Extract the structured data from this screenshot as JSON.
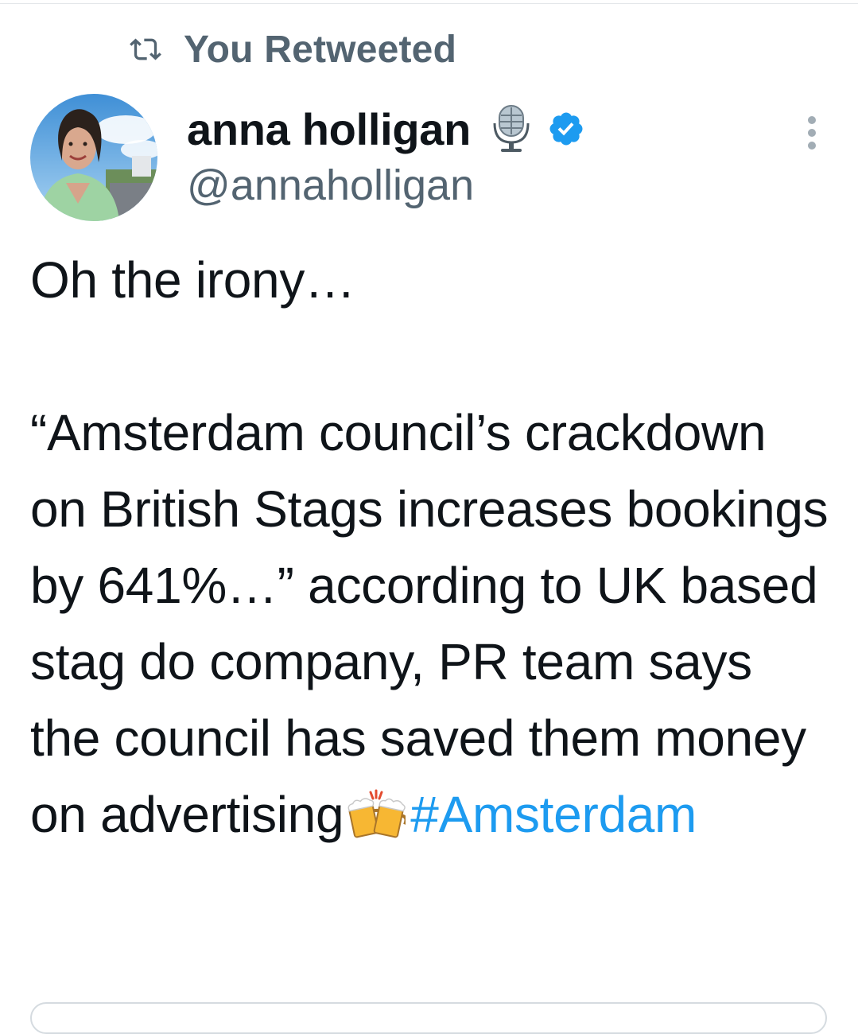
{
  "retweet_banner": {
    "icon": "retweet-icon",
    "label": "You Retweeted"
  },
  "author": {
    "display_name": "anna holligan",
    "handle": "@annaholligan",
    "name_emoji": "studio-microphone-icon",
    "verified_badge": "verified-badge-icon",
    "badge_color": "#1d9bf0"
  },
  "menu": {
    "icon": "more-options-icon"
  },
  "tweet": {
    "line1": "Oh the irony…",
    "body": "“Amsterdam council’s crackdown on British Stags increases bookings by 641%…” according to UK based stag do company, PR team says the council has saved them money on advertising",
    "emoji": "clinking-beer-mugs-icon",
    "hashtag": "#Amsterdam"
  },
  "colors": {
    "text": "#0f1419",
    "secondary": "#536471",
    "link": "#1d9bf0",
    "border": "#d5dbe0"
  }
}
